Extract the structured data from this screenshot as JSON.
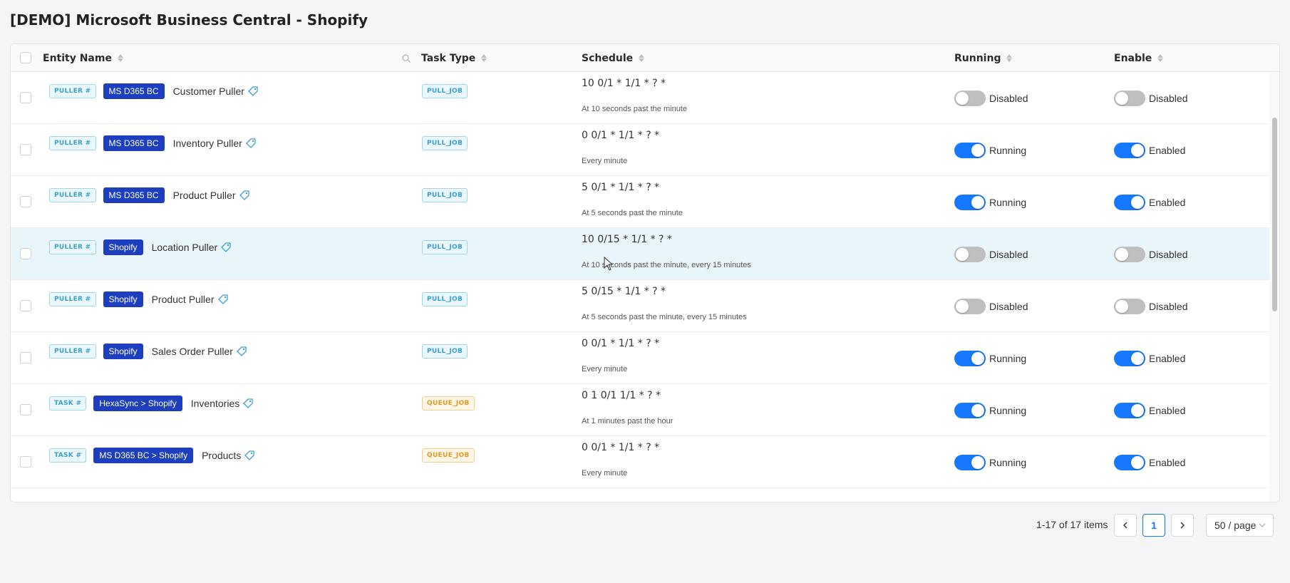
{
  "page": {
    "title": "[DEMO] Microsoft Business Central - Shopify"
  },
  "columns": {
    "entity_name": "Entity Name",
    "task_type": "Task Type",
    "schedule": "Schedule",
    "running": "Running",
    "enable": "Enable"
  },
  "rows": [
    {
      "kind": "PULLER #",
      "connector": "MS D365 BC",
      "name": "Customer Puller",
      "task_type": "PULL_JOB",
      "task_style": "pull",
      "cron": "10 0/1 * 1/1 * ? *",
      "desc": "At 10 seconds past the minute",
      "running": false,
      "running_label": "Disabled",
      "enabled": false,
      "enable_label": "Disabled"
    },
    {
      "kind": "PULLER #",
      "connector": "MS D365 BC",
      "name": "Inventory Puller",
      "task_type": "PULL_JOB",
      "task_style": "pull",
      "cron": "0 0/1 * 1/1 * ? *",
      "desc": "Every minute",
      "running": true,
      "running_label": "Running",
      "enabled": true,
      "enable_label": "Enabled"
    },
    {
      "kind": "PULLER #",
      "connector": "MS D365 BC",
      "name": "Product Puller",
      "task_type": "PULL_JOB",
      "task_style": "pull",
      "cron": "5 0/1 * 1/1 * ? *",
      "desc": "At 5 seconds past the minute",
      "running": true,
      "running_label": "Running",
      "enabled": true,
      "enable_label": "Enabled"
    },
    {
      "kind": "PULLER #",
      "connector": "Shopify",
      "name": "Location Puller",
      "task_type": "PULL_JOB",
      "task_style": "pull",
      "cron": "10 0/15 * 1/1 * ? *",
      "desc": "At 10 seconds past the minute, every 15 minutes",
      "running": false,
      "running_label": "Disabled",
      "enabled": false,
      "enable_label": "Disabled"
    },
    {
      "kind": "PULLER #",
      "connector": "Shopify",
      "name": "Product Puller",
      "task_type": "PULL_JOB",
      "task_style": "pull",
      "cron": "5 0/15 * 1/1 * ? *",
      "desc": "At 5 seconds past the minute, every 15 minutes",
      "running": false,
      "running_label": "Disabled",
      "enabled": false,
      "enable_label": "Disabled"
    },
    {
      "kind": "PULLER #",
      "connector": "Shopify",
      "name": "Sales Order Puller",
      "task_type": "PULL_JOB",
      "task_style": "pull",
      "cron": "0 0/1 * 1/1 * ? *",
      "desc": "Every minute",
      "running": true,
      "running_label": "Running",
      "enabled": true,
      "enable_label": "Enabled"
    },
    {
      "kind": "TASK #",
      "connector": "HexaSync > Shopify",
      "name": "Inventories",
      "task_type": "QUEUE_JOB",
      "task_style": "queue",
      "cron": "0 1 0/1 1/1 * ? *",
      "desc": "At 1 minutes past the hour",
      "running": true,
      "running_label": "Running",
      "enabled": true,
      "enable_label": "Enabled"
    },
    {
      "kind": "TASK #",
      "connector": "MS D365 BC > Shopify",
      "name": "Products",
      "task_type": "QUEUE_JOB",
      "task_style": "queue",
      "cron": "0 0/1 * 1/1 * ? *",
      "desc": "Every minute",
      "running": true,
      "running_label": "Running",
      "enabled": true,
      "enable_label": "Enabled"
    }
  ],
  "pagination": {
    "total_text": "1-17 of 17 items",
    "prev": "‹",
    "current": "1",
    "next": "›",
    "page_size": "50 / page"
  },
  "colors": {
    "accent": "#1677ff",
    "connector": "#1d3fbf",
    "switch_off": "#bfbfbf"
  }
}
